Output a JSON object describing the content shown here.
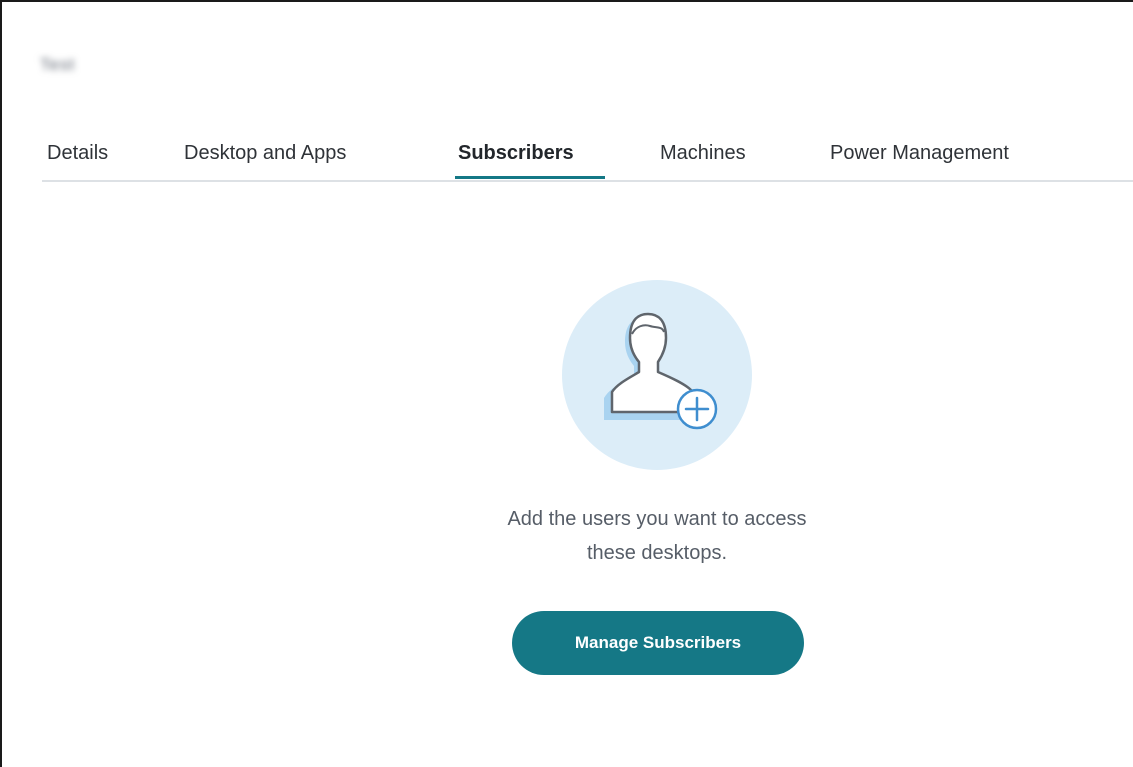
{
  "page": {
    "title": "Test"
  },
  "tabs": [
    {
      "label": "Details",
      "active": false
    },
    {
      "label": "Desktop and Apps",
      "active": false
    },
    {
      "label": "Subscribers",
      "active": true
    },
    {
      "label": "Machines",
      "active": false
    },
    {
      "label": "Power Management",
      "active": false
    }
  ],
  "empty_state": {
    "icon": "add-user-icon",
    "message_line1": "Add the users you want to access",
    "message_line2": "these desktops.",
    "button_label": "Manage Subscribers"
  },
  "colors": {
    "accent": "#147886",
    "button_bg": "#157886",
    "illustration_circle": "#dcedf8",
    "illustration_shadow": "#a9d3f0"
  }
}
